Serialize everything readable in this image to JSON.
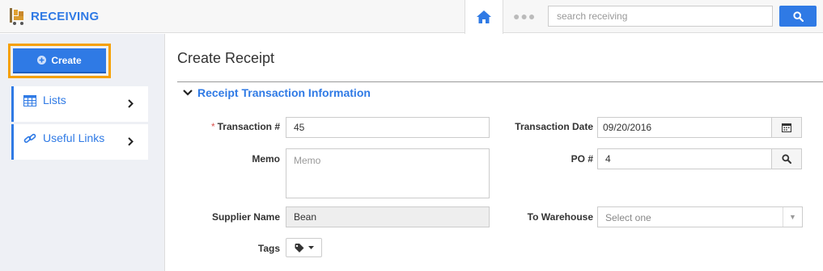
{
  "app": {
    "title": "RECEIVING",
    "logo_icon": "cart-icon"
  },
  "header": {
    "home_icon": "home-icon",
    "more_label": "●●●",
    "search": {
      "placeholder": "search receiving",
      "value": ""
    },
    "search_icon": "search-icon"
  },
  "sidebar": {
    "create_label": "Create",
    "items": [
      {
        "label": "Lists",
        "icon": "table-icon"
      },
      {
        "label": "Useful Links",
        "icon": "link-icon"
      }
    ]
  },
  "main": {
    "page_title": "Create Receipt",
    "section_title": "Receipt Transaction Information",
    "form": {
      "required_marker": "*",
      "transaction_no": {
        "label": "Transaction #",
        "value": "45"
      },
      "memo": {
        "label": "Memo",
        "placeholder": "Memo",
        "value": ""
      },
      "supplier_name": {
        "label": "Supplier Name",
        "value": "Bean"
      },
      "tags": {
        "label": "Tags"
      },
      "transaction_date": {
        "label": "Transaction Date",
        "value": "09/20/2016"
      },
      "po_no": {
        "label": "PO #",
        "value": "4"
      },
      "to_warehouse": {
        "label": "To Warehouse",
        "placeholder": "Select one"
      }
    }
  },
  "colors": {
    "accent": "#2f7ae5",
    "highlight": "#f5a000",
    "required": "#d9534f"
  }
}
